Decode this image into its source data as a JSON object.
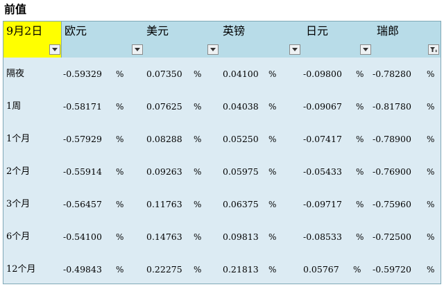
{
  "title": "前值",
  "date_header": "9月2日",
  "currencies": [
    "欧元",
    "美元",
    "英镑",
    "日元",
    "瑞郎"
  ],
  "unit": "%",
  "rows": [
    {
      "tenor": "隔夜",
      "values": [
        "-0.59329",
        "0.07350",
        "0.04100",
        "-0.09800",
        "-0.78280"
      ]
    },
    {
      "tenor": "1周",
      "values": [
        "-0.58171",
        "0.07625",
        "0.04038",
        "-0.09067",
        "-0.81780"
      ]
    },
    {
      "tenor": "1个月",
      "values": [
        "-0.57929",
        "0.08288",
        "0.05250",
        "-0.07417",
        "-0.78900"
      ]
    },
    {
      "tenor": "2个月",
      "values": [
        "-0.55914",
        "0.09263",
        "0.05975",
        "-0.05433",
        "-0.76900"
      ]
    },
    {
      "tenor": "3个月",
      "values": [
        "-0.56457",
        "0.11763",
        "0.06375",
        "-0.09717",
        "-0.75960"
      ]
    },
    {
      "tenor": "6个月",
      "values": [
        "-0.54100",
        "0.14763",
        "0.09813",
        "-0.08533",
        "-0.72500"
      ]
    },
    {
      "tenor": "12个月",
      "values": [
        "-0.49843",
        "0.22275",
        "0.21813",
        "0.05767",
        "-0.59720"
      ]
    }
  ],
  "filter_buttons": [
    "dropdown-arrow-icon",
    "dropdown-arrow-icon",
    "dropdown-arrow-icon",
    "dropdown-arrow-icon",
    "dropdown-arrow-icon",
    "filter-applied-icon"
  ],
  "colors": {
    "date_highlight": "#ffff00",
    "header_bg": "#b8dce8",
    "body_bg": "#dcebf3",
    "border": "#7fa8b6"
  }
}
